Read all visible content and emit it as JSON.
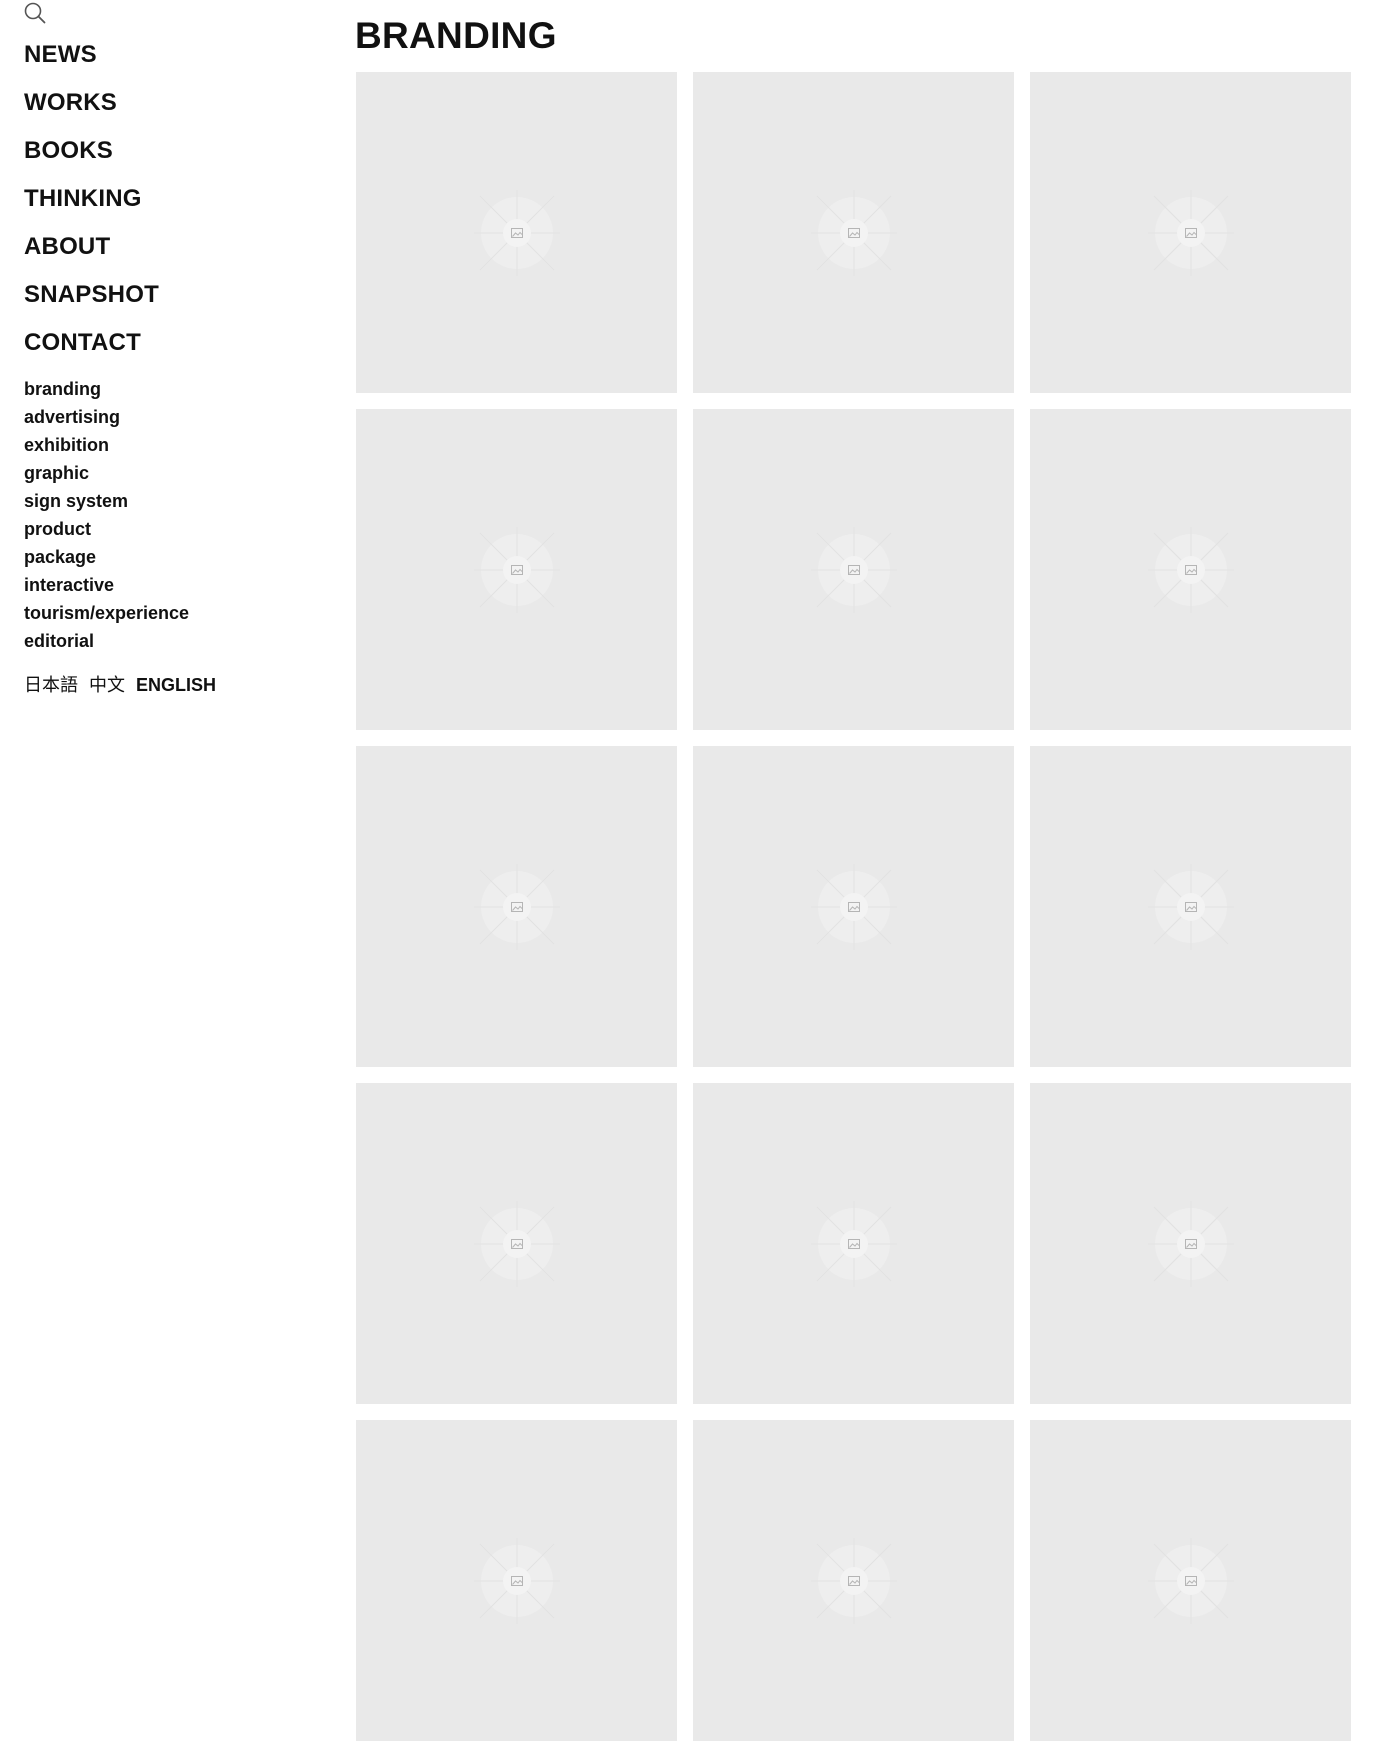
{
  "search": {
    "icon": "search-icon"
  },
  "nav": {
    "main": [
      "NEWS",
      "WORKS",
      "BOOKS",
      "THINKING",
      "ABOUT",
      "SNAPSHOT",
      "CONTACT"
    ],
    "categories": [
      "branding",
      "advertising",
      "exhibition",
      "graphic",
      "sign system",
      "product",
      "package",
      "interactive",
      "tourism/experience",
      "editorial"
    ]
  },
  "languages": {
    "items": [
      "日本語",
      "中文",
      "ENGLISH"
    ],
    "active": "ENGLISH"
  },
  "page": {
    "title": "BRANDING"
  },
  "grid": {
    "tile_count": 15,
    "tile_icon": "image-placeholder-icon"
  },
  "colors": {
    "tile_background": "#e9e9e9",
    "text": "#111111",
    "page_background": "#ffffff"
  }
}
